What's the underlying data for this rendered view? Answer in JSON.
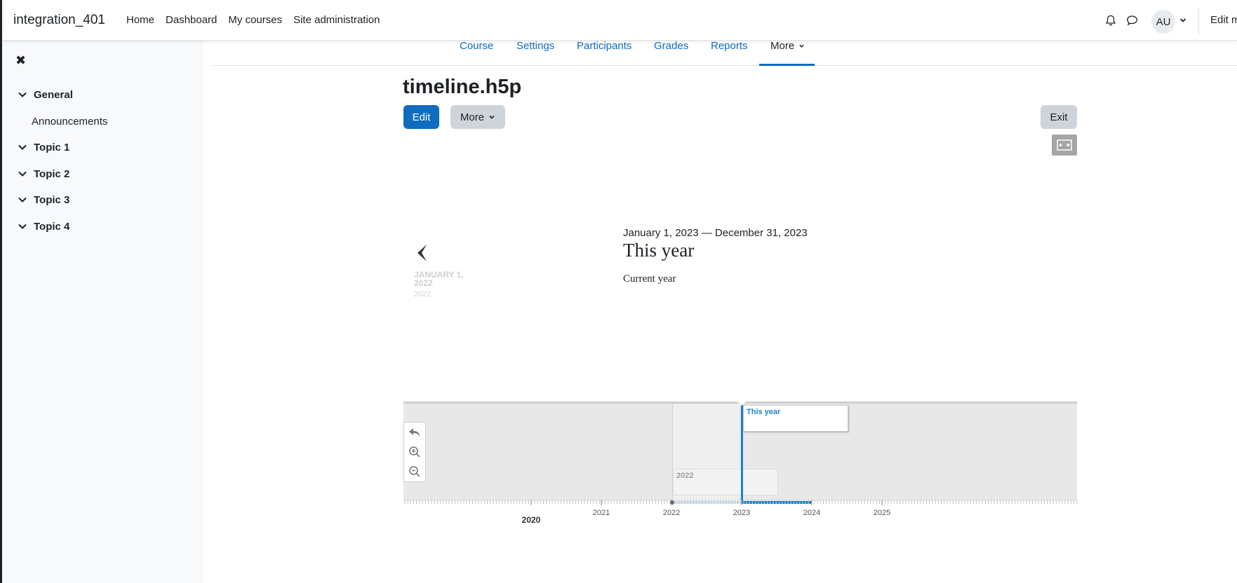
{
  "navbar": {
    "brand": "integration_401",
    "links": [
      "Home",
      "Dashboard",
      "My courses",
      "Site administration"
    ],
    "avatar_initials": "AU",
    "edit_mode_label": "Edit m"
  },
  "drawer": {
    "sections": [
      {
        "label": "General",
        "activities": [
          "Announcements"
        ]
      },
      {
        "label": "Topic 1",
        "activities": []
      },
      {
        "label": "Topic 2",
        "activities": []
      },
      {
        "label": "Topic 3",
        "activities": []
      },
      {
        "label": "Topic 4",
        "activities": []
      }
    ]
  },
  "secondary_nav": {
    "tabs": [
      "Course",
      "Settings",
      "Participants",
      "Grades",
      "Reports",
      "More"
    ],
    "active_tab": "More"
  },
  "page": {
    "title": "timeline.h5p",
    "edit_label": "Edit",
    "more_label": "More",
    "exit_label": "Exit"
  },
  "slide": {
    "prev_date": "JANUARY 1, 2022",
    "prev_year": "2022",
    "date_range": "January 1, 2023 — December 31, 2023",
    "headline": "This year",
    "text": "Current year"
  },
  "timenav": {
    "marker_title": "This year",
    "era_title": "2022",
    "axis_years": [
      "2021",
      "2022",
      "2023",
      "2024",
      "2025"
    ],
    "major_year": "2020"
  },
  "colors": {
    "primary": "#0f6cbf",
    "timeline_accent": "#1a82cc"
  }
}
